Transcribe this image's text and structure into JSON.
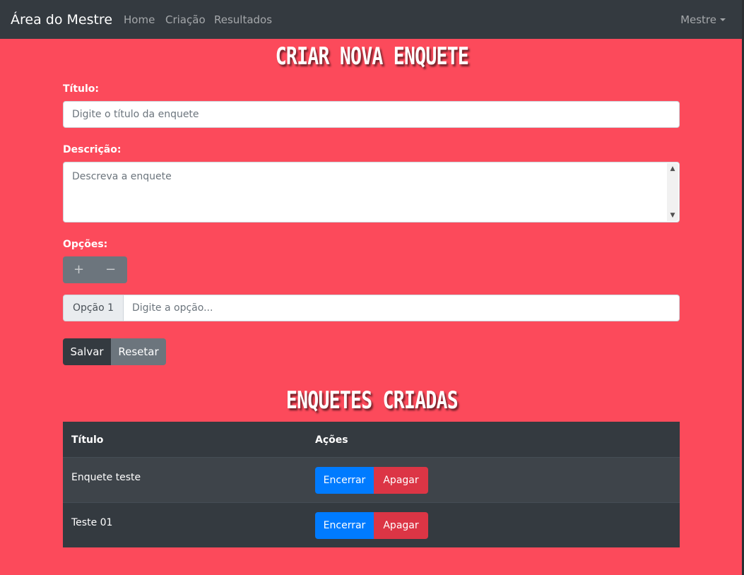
{
  "navbar": {
    "brand": "Área do Mestre",
    "links": [
      "Home",
      "Criação",
      "Resultados"
    ],
    "user_menu": "Mestre"
  },
  "form": {
    "heading": "CRIAR NOVA ENQUETE",
    "title_label": "Título:",
    "title_placeholder": "Digite o título da enquete",
    "description_label": "Descrição:",
    "description_placeholder": "Descreva a enquete",
    "options_label": "Opções:",
    "add_option": "+",
    "remove_option": "−",
    "option_prefix": "Opção 1",
    "option_placeholder": "Digite a opção...",
    "save_label": "Salvar",
    "reset_label": "Resetar"
  },
  "list": {
    "heading": "ENQUETES CRIADAS",
    "columns": [
      "Título",
      "Ações"
    ],
    "rows": [
      {
        "title": "Enquete teste",
        "close_label": "Encerrar",
        "delete_label": "Apagar"
      },
      {
        "title": "Teste 01",
        "close_label": "Encerrar",
        "delete_label": "Apagar"
      }
    ]
  },
  "colors": {
    "page_background": "#fc4a5b",
    "navbar": "#343a40",
    "primary": "#007bff",
    "danger": "#dc3545",
    "secondary": "#6c757d"
  }
}
